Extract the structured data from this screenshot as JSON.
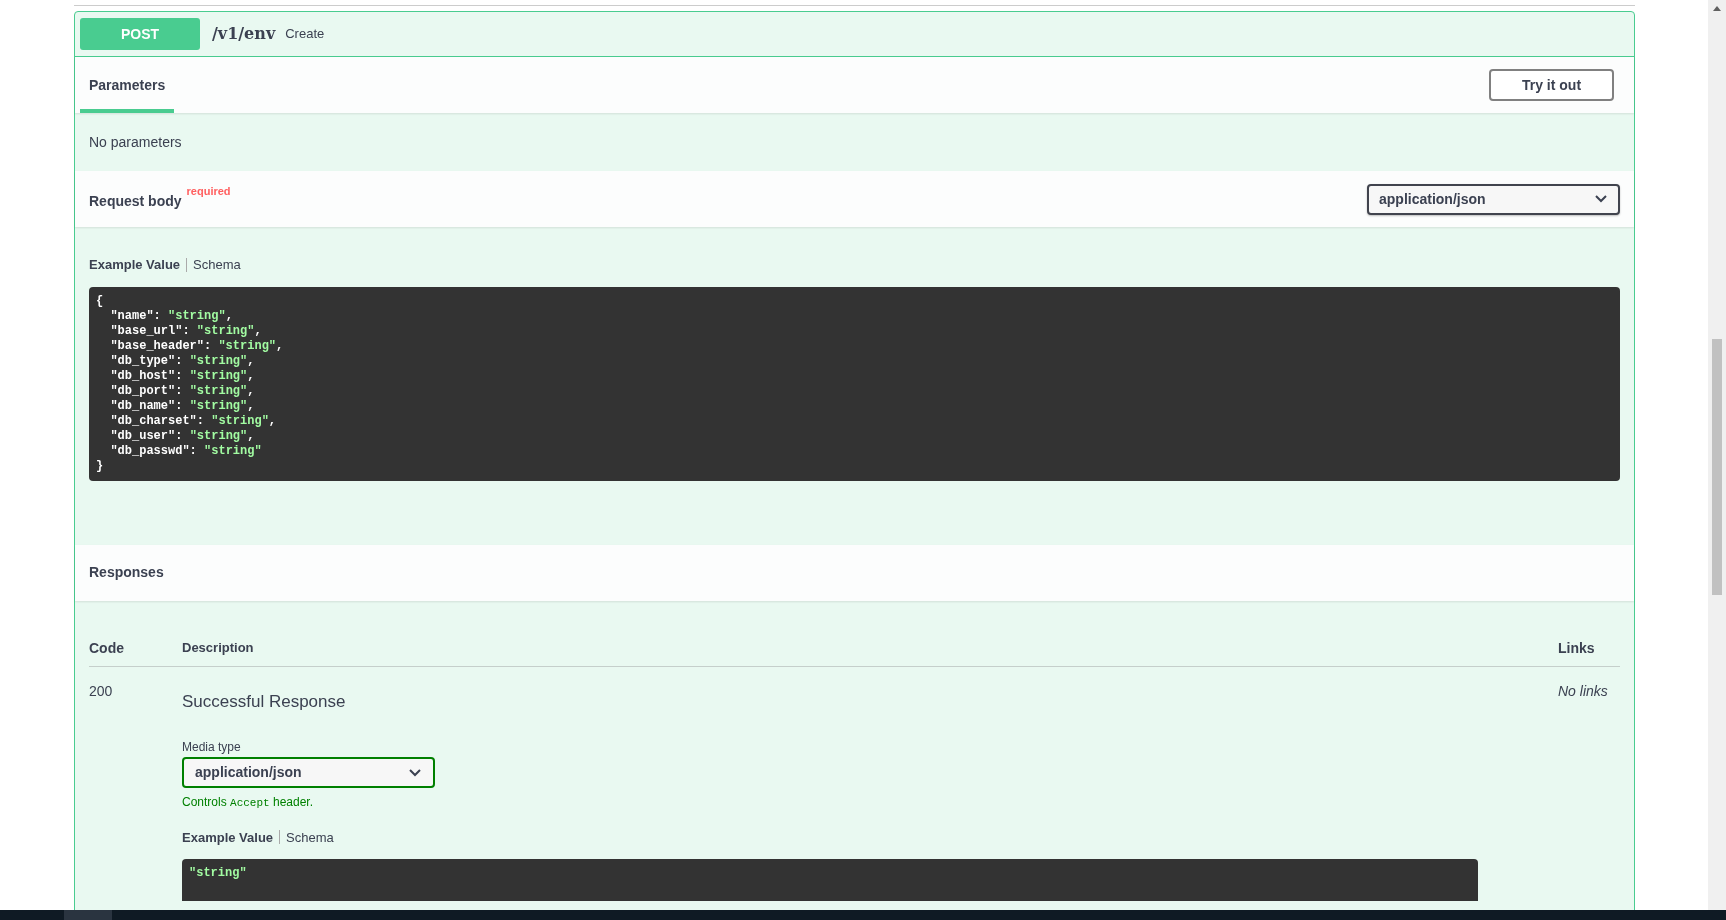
{
  "operation": {
    "method": "POST",
    "path": "/v1/env",
    "summary": "Create"
  },
  "parameters": {
    "tabs": [
      {
        "label": "Parameters",
        "selected": true
      }
    ],
    "try_button": "Try it out",
    "empty_text": "No parameters"
  },
  "request_body": {
    "title": "Request body",
    "required_label": "required",
    "content_type": "application/json",
    "example_tabs": [
      {
        "label": "Example Value",
        "selected": true
      },
      {
        "label": "Schema",
        "selected": false
      }
    ],
    "code_lines": [
      {
        "kind": "punct",
        "text": "{"
      },
      {
        "kind": "pair",
        "key": "  \"name\": ",
        "value": "\"string\"",
        "tail": ","
      },
      {
        "kind": "pair",
        "key": "  \"base_url\": ",
        "value": "\"string\"",
        "tail": ","
      },
      {
        "kind": "pair",
        "key": "  \"base_header\": ",
        "value": "\"string\"",
        "tail": ","
      },
      {
        "kind": "pair",
        "key": "  \"db_type\": ",
        "value": "\"string\"",
        "tail": ","
      },
      {
        "kind": "pair",
        "key": "  \"db_host\": ",
        "value": "\"string\"",
        "tail": ","
      },
      {
        "kind": "pair",
        "key": "  \"db_port\": ",
        "value": "\"string\"",
        "tail": ","
      },
      {
        "kind": "pair",
        "key": "  \"db_name\": ",
        "value": "\"string\"",
        "tail": ","
      },
      {
        "kind": "pair",
        "key": "  \"db_charset\": ",
        "value": "\"string\"",
        "tail": ","
      },
      {
        "kind": "pair",
        "key": "  \"db_user\": ",
        "value": "\"string\"",
        "tail": ","
      },
      {
        "kind": "pair",
        "key": "  \"db_passwd\": ",
        "value": "\"string\""
      },
      {
        "kind": "punct",
        "text": "}"
      }
    ]
  },
  "responses": {
    "title": "Responses",
    "columns": [
      "Code",
      "Description",
      "Links"
    ],
    "rows": [
      {
        "code": "200",
        "description": "Successful Response",
        "links": "No links",
        "media_type_label": "Media type",
        "media_type": "application/json",
        "controls_note": {
          "before": "Controls ",
          "code": "Accept",
          "after": " header."
        },
        "example_tabs": [
          {
            "label": "Example Value",
            "selected": true
          },
          {
            "label": "Schema",
            "selected": false
          }
        ],
        "example_lines": [
          {
            "kind": "string",
            "text": "\"string\""
          }
        ]
      }
    ]
  }
}
